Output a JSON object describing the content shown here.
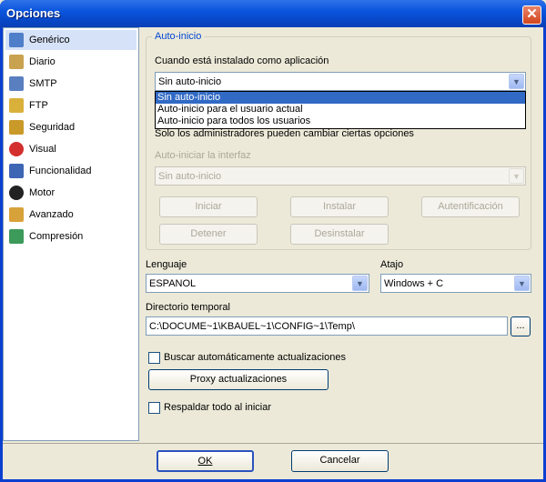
{
  "window": {
    "title": "Opciones",
    "close_glyph": "✕"
  },
  "sidebar": {
    "items": [
      {
        "label": "Genérico",
        "icon": "list-icon",
        "color": "#4f7fc9"
      },
      {
        "label": "Diario",
        "icon": "notebook-icon",
        "color": "#c9a24f"
      },
      {
        "label": "SMTP",
        "icon": "envelope-icon",
        "color": "#5a7fc1"
      },
      {
        "label": "FTP",
        "icon": "key-icon",
        "color": "#d9b13a"
      },
      {
        "label": "Seguridad",
        "icon": "padlock-icon",
        "color": "#c99a2a"
      },
      {
        "label": "Visual",
        "icon": "heart-icon",
        "color": "#d42f2f"
      },
      {
        "label": "Funcionalidad",
        "icon": "computer-icon",
        "color": "#3f66b5"
      },
      {
        "label": "Motor",
        "icon": "bomb-icon",
        "color": "#222222"
      },
      {
        "label": "Avanzado",
        "icon": "box-icon",
        "color": "#d8a23a"
      },
      {
        "label": "Compresión",
        "icon": "archive-icon",
        "color": "#3c9a5a"
      }
    ]
  },
  "autoinicio": {
    "legend": "Auto-inicio",
    "installed_label": "Cuando está instalado como aplicación",
    "installed_value": "Sin auto-inicio",
    "options": [
      "Sin auto-inicio",
      "Auto-inicio para el usuario actual",
      "Auto-inicio para todos los usuarios"
    ],
    "admin_note": "Solo los administradores pueden cambiar ciertas opciones",
    "interface_label": "Auto-iniciar la interfaz",
    "interface_value": "Sin auto-inicio",
    "buttons": {
      "iniciar": "Iniciar",
      "instalar": "Instalar",
      "autentificacion": "Autentificación",
      "detener": "Detener",
      "desinstalar": "Desinstalar"
    }
  },
  "lenguaje": {
    "label": "Lenguaje",
    "value": "ESPANOL"
  },
  "atajo": {
    "label": "Atajo",
    "value": "Windows + C"
  },
  "directorio": {
    "label": "Directorio temporal",
    "value": "C:\\DOCUME~1\\KBAUEL~1\\CONFIG~1\\Temp\\",
    "browse_label": "..."
  },
  "buscar_actualizaciones": {
    "label": "Buscar automáticamente actualizaciones",
    "checked": false
  },
  "proxy_button": "Proxy actualizaciones",
  "respaldar": {
    "label": "Respaldar todo al iniciar",
    "checked": false
  },
  "footer": {
    "ok": "OK",
    "cancel": "Cancelar"
  },
  "colors": {
    "title_bar": "#0a55dd",
    "selection": "#316ac5",
    "legend": "#0046d5"
  }
}
